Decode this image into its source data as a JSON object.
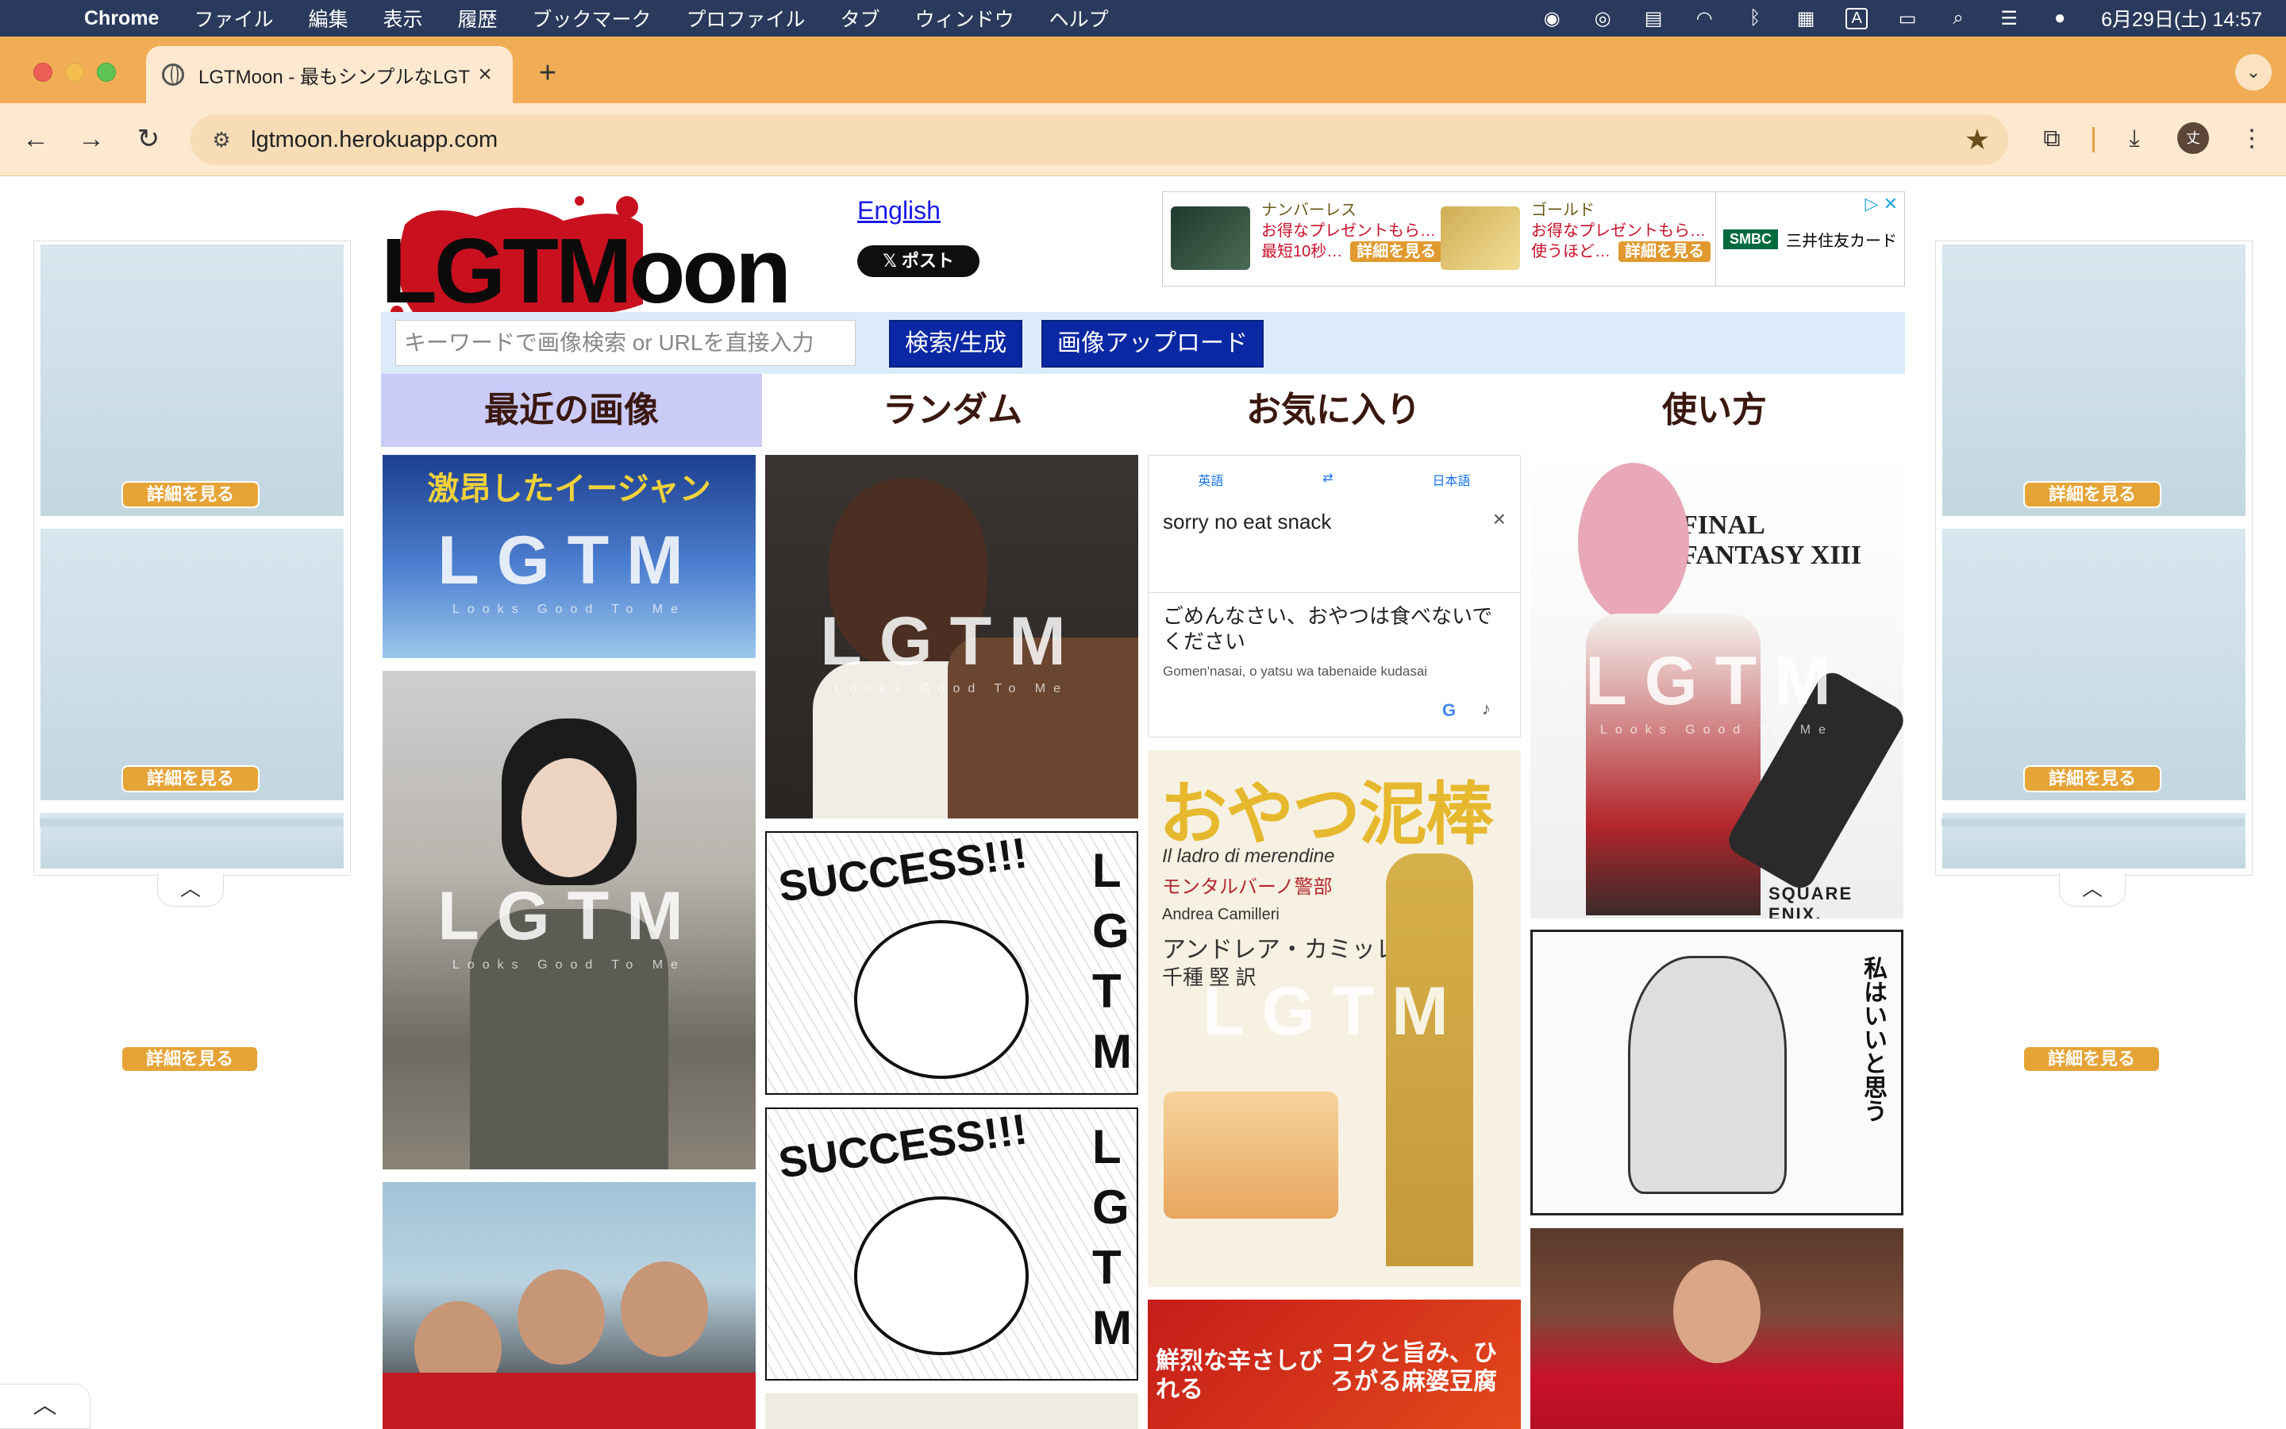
{
  "menubar": {
    "app_name": "Chrome",
    "items": [
      "ファイル",
      "編集",
      "表示",
      "履歴",
      "ブックマーク",
      "プロファイル",
      "タブ",
      "ウィンドウ",
      "ヘルプ"
    ],
    "clock": "6月29日(土) 14:57",
    "input_mode": "A"
  },
  "browser": {
    "tab_title": "LGTMoon - 最もシンプルなLGT",
    "url": "lgtmoon.herokuapp.com",
    "profile_initial": "丈"
  },
  "header": {
    "logo_text": "LGTMoon",
    "lang_link": "English",
    "x_post_label": "𝕏 ポスト"
  },
  "top_ad": {
    "products": [
      {
        "name": "ナンバーレス",
        "desc": "お得なプレゼントもら…",
        "note": "最短10秒…",
        "cta": "詳細を見る"
      },
      {
        "name": "ゴールド",
        "desc": "お得なプレゼントもら…",
        "note": "使うほど…",
        "cta": "詳細を見る"
      }
    ],
    "sponsor_mark": "SMBC",
    "sponsor_name": "三井住友カード"
  },
  "side_ads": {
    "cta": "詳細を見る"
  },
  "search": {
    "placeholder": "キーワードで画像検索 or URLを直接入力",
    "search_label": "検索/生成",
    "upload_label": "画像アップロード"
  },
  "tabs": [
    {
      "label": "最近の画像",
      "active": true
    },
    {
      "label": "ランダム",
      "active": false
    },
    {
      "label": "お気に入り",
      "active": false
    },
    {
      "label": "使い方",
      "active": false
    }
  ],
  "tiles": {
    "lgtm": "LGTM",
    "lgtm_sub": "Looks Good To Me",
    "col1": {
      "t1_caption": "激昂したイージャン"
    },
    "col2": {
      "manga_word": "SUCCESS!!!",
      "manga_side": "LGTM"
    },
    "col3": {
      "src_lang": "英語",
      "tgt_lang": "日本語",
      "src_text": "sorry no eat snack",
      "result_text": "ごめんなさい、おやつは食べないでください",
      "roman_text": "Gomen'nasai, o yatsu wa tabenaide kudasai",
      "book_title": "おやつ泥棒",
      "book_it": "Il ladro di merendine",
      "book_series": "モンタルバーノ警部",
      "book_author_en": "Andrea Camilleri",
      "book_author": "アンドレア・カミッレーリ",
      "book_translator": "千種 堅 訳",
      "bottom_a": "鮮烈な辛さしびれる",
      "bottom_b": "コクと旨み、ひろがる麻婆豆腐"
    },
    "col4": {
      "ff_title": "FINAL FANTASY XIII",
      "ff_brand": "SQUARE ENIX.",
      "manga_speech": "私はいいと思う"
    }
  }
}
